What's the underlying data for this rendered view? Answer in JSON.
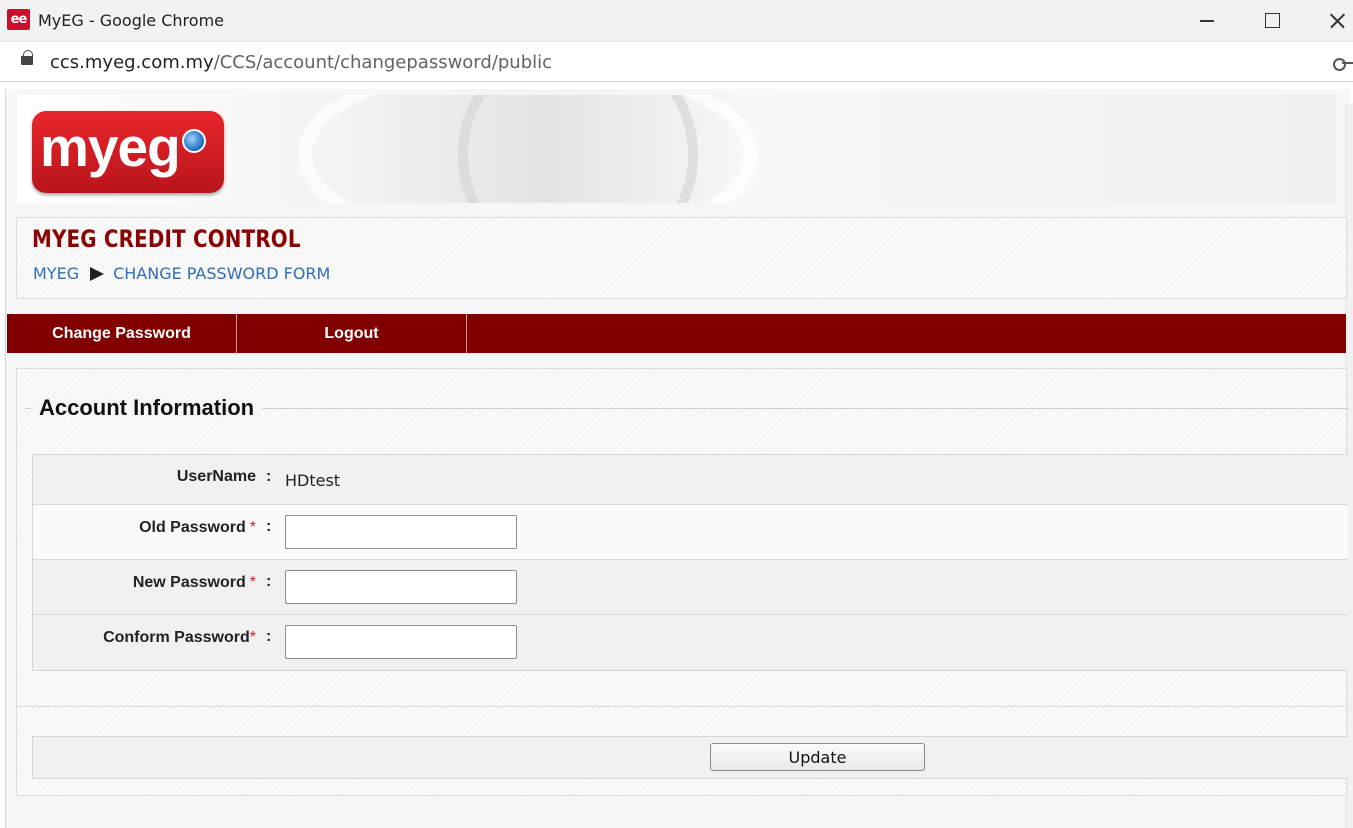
{
  "window": {
    "app_icon_text": "ee",
    "title": "MyEG - Google Chrome"
  },
  "address": {
    "domain": "ccs.myeg.com.my",
    "path": "/CCS/account/changepassword/public"
  },
  "logo": {
    "text": "myeg"
  },
  "header": {
    "app_title": "MYEG CREDIT CONTROL",
    "breadcrumb": [
      "MYEG",
      "CHANGE PASSWORD FORM"
    ]
  },
  "menu": {
    "items": [
      {
        "label": "Change Password"
      },
      {
        "label": "Logout"
      }
    ]
  },
  "form": {
    "legend": "Account Information",
    "username": {
      "label": "UserName",
      "value": "HDtest"
    },
    "old_password": {
      "label": "Old Password",
      "required_mark": "*",
      "value": ""
    },
    "new_password": {
      "label": "New Password",
      "required_mark": "*",
      "value": ""
    },
    "confirm_password": {
      "label": "Conform Password",
      "required_mark": "*",
      "value": ""
    },
    "colon": ":",
    "submit_label": "Update"
  },
  "colors": {
    "brand_red": "#800000",
    "title_red": "#8b0000",
    "link_blue": "#2f6db5",
    "required_red": "#d42020"
  }
}
